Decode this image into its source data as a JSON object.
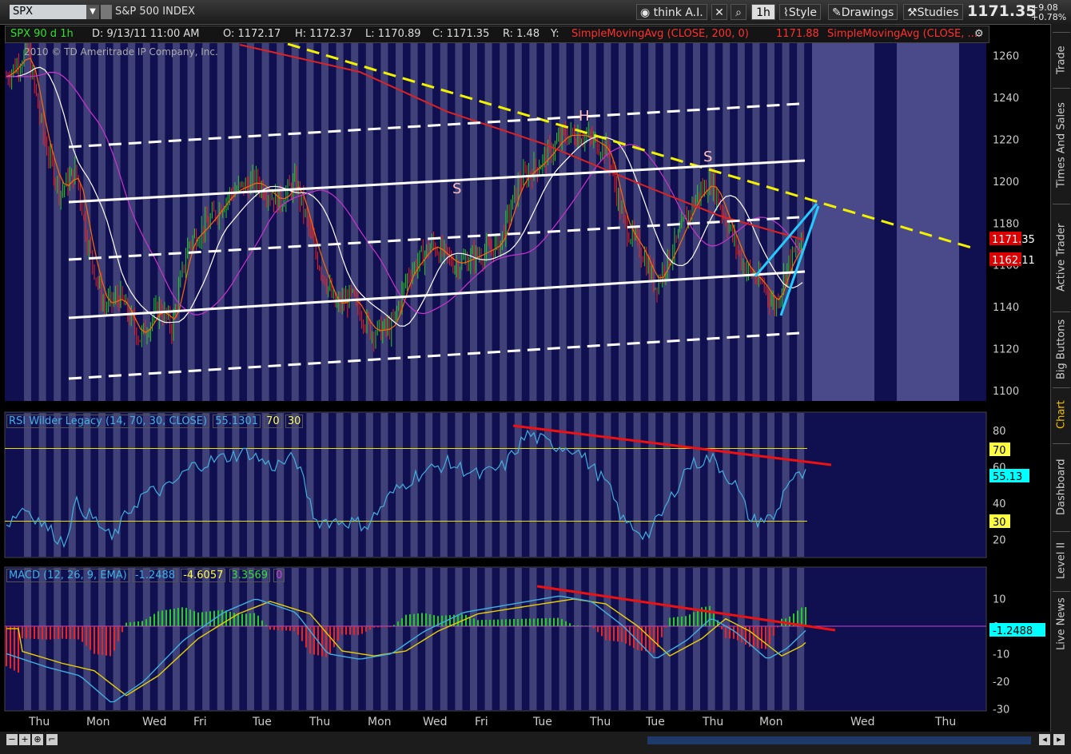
{
  "toolbar": {
    "symbol": "SPX",
    "symbol_name": "S&P 500 INDEX",
    "think_label": "think A.I.",
    "timeframe": "1h",
    "style_label": "Style",
    "drawings_label": "Drawings",
    "studies_label": "Studies",
    "last_price": "1171.35",
    "change_abs": "+9.08",
    "change_pct": "+0.78%"
  },
  "infobar": {
    "period": "SPX 90 d 1h",
    "date": "D: 9/13/11 11:00 AM",
    "open": "O: 1172.17",
    "high": "H: 1172.37",
    "low": "L: 1170.89",
    "close": "C: 1171.35",
    "range": "R: 1.48",
    "y": "Y:",
    "sma200": "SimpleMovingAvg (CLOSE, 200, 0)",
    "sma200_value": "1171.88",
    "sma_other": "SimpleMovingAvg (CLOSE, ..."
  },
  "copyright": "2010 © TD Ameritrade IP Company, Inc.",
  "price_chart": {
    "y_ticks": [
      "1260",
      "1240",
      "1220",
      "1200",
      "1180",
      "1160",
      "1140",
      "1120",
      "1100"
    ],
    "price_tag_last": "1171.35",
    "price_tag_sma": "1162.11",
    "annotations": [
      "S",
      "H",
      "S"
    ]
  },
  "rsi": {
    "label": "RSI Wilder Legacy (14, 70, 30, CLOSE)",
    "value": "55.1301",
    "ob": "70",
    "os": "30",
    "y_ticks": [
      "80",
      "60",
      "40",
      "20"
    ],
    "tag_value": "55.13",
    "tag_ob": "70",
    "tag_os": "30"
  },
  "macd": {
    "label": "MACD (12, 26, 9, EMA)",
    "value": "-1.2488",
    "avg": "-4.6057",
    "diff": "3.3569",
    "zero": "0",
    "y_ticks": [
      "10",
      "0",
      "-10",
      "-20",
      "-30"
    ],
    "tag_value": "-1.2488"
  },
  "x_labels": [
    "Thu",
    "Mon",
    "Wed",
    "Fri",
    "Tue",
    "Thu",
    "Mon",
    "Wed",
    "Fri",
    "Tue",
    "Thu",
    "Tue",
    "Thu",
    "Mon",
    "Wed",
    "Thu"
  ],
  "sidebar_tabs": [
    "Trade",
    "Times And Sales",
    "Active Trader",
    "Big Buttons",
    "Chart",
    "Dashboard",
    "Level II",
    "Live News"
  ],
  "colors": {
    "chart_bg": "#101050",
    "price_up": "#22cc22",
    "price_down": "#ee2222",
    "trend_yellow": "#f2f200",
    "channel_white": "#ffffff",
    "wedge_cyan": "#22ccff",
    "sma_red": "#dd2222",
    "rsi_line": "#3fb0e0",
    "macd_line": "#3fb0e0",
    "macd_avg": "#e8d000"
  }
}
